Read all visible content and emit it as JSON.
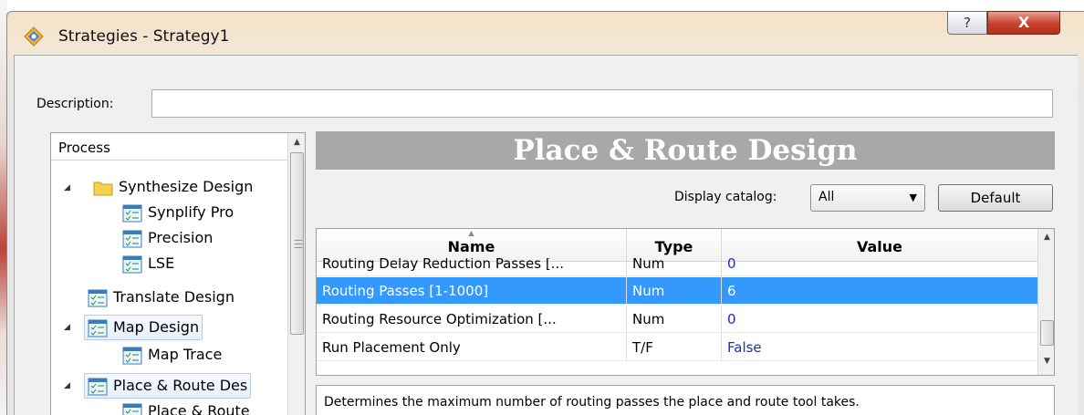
{
  "window": {
    "title": "Strategies - Strategy1",
    "help_label": "?",
    "close_label": "X"
  },
  "description": {
    "label": "Description:",
    "value": ""
  },
  "process_tree": {
    "header": "Process",
    "items": [
      {
        "label": "Synthesize Design",
        "level": 0,
        "expanded": true,
        "icon": "folder-icon"
      },
      {
        "label": "Synplify Pro",
        "level": 1,
        "icon": "strategy-icon"
      },
      {
        "label": "Precision",
        "level": 1,
        "icon": "strategy-icon"
      },
      {
        "label": "LSE",
        "level": 1,
        "icon": "strategy-icon"
      },
      {
        "label": "Translate Design",
        "level": 0,
        "icon": "strategy-icon"
      },
      {
        "label": "Map Design",
        "level": 0,
        "expanded": true,
        "icon": "strategy-icon"
      },
      {
        "label": "Map Trace",
        "level": 1,
        "icon": "strategy-icon"
      },
      {
        "label": "Place & Route Des",
        "level": 0,
        "expanded": true,
        "icon": "strategy-icon",
        "selected": true
      },
      {
        "label": "Place & Route",
        "level": 1,
        "icon": "strategy-icon"
      }
    ]
  },
  "panel": {
    "banner": "Place & Route Design",
    "catalog_label": "Display catalog:",
    "catalog_value": "All",
    "default_button": "Default"
  },
  "grid": {
    "columns": [
      "Name",
      "Type",
      "Value"
    ],
    "rows": [
      {
        "name": "Routing Delay Reduction Passes [...",
        "type": "Num",
        "value": "0"
      },
      {
        "name": "Routing Passes [1-1000]",
        "type": "Num",
        "value": "6",
        "selected": true
      },
      {
        "name": "Routing Resource Optimization [...",
        "type": "Num",
        "value": "0"
      },
      {
        "name": "Run Placement Only",
        "type": "T/F",
        "value": "False"
      }
    ]
  },
  "help_text": "Determines the maximum number of routing passes the place and route tool takes.",
  "colors": {
    "selection": "#3399ff",
    "banner": "#a8a8a8",
    "value_text": "#1c2cc4",
    "close_button": "#c7402c"
  }
}
